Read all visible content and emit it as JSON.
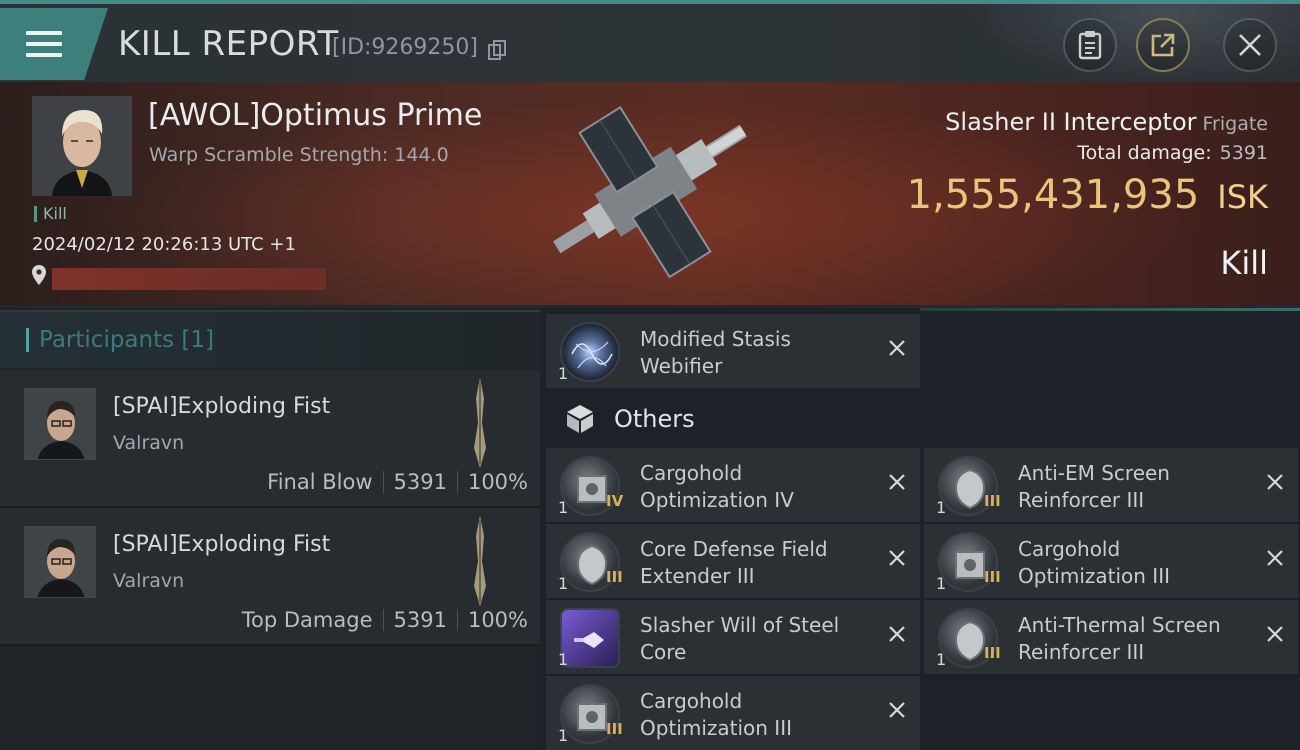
{
  "header": {
    "title": "KILL REPORT",
    "id_text": "[ID:9269250]"
  },
  "victim": {
    "name": "[AWOL]Optimus Prime",
    "subtitle": "Warp Scramble Strength: 144.0",
    "tag": "Kill",
    "datetime": "2024/02/12 20:26:13 UTC +1",
    "ship_name": "Slasher II Interceptor",
    "ship_class": "Frigate",
    "total_damage_label": "Total damage:",
    "total_damage": "5391",
    "isk_value": "1,555,431,935",
    "isk_unit": "ISK",
    "result": "Kill"
  },
  "participants": {
    "title": "Participants [1]",
    "rows": [
      {
        "name": "[SPAI]Exploding Fist",
        "ship": "Valravn",
        "role": "Final Blow",
        "damage": "5391",
        "percent": "100%"
      },
      {
        "name": "[SPAI]Exploding Fist",
        "ship": "Valravn",
        "role": "Top Damage",
        "damage": "5391",
        "percent": "100%"
      }
    ]
  },
  "modules": {
    "top": {
      "name": "Modified Stasis\nWebifier",
      "qty": "1",
      "icon": "stasis-webifier-icon",
      "tier": ""
    },
    "others_label": "Others",
    "left": [
      {
        "name": "Cargohold\nOptimization IV",
        "qty": "1",
        "tier": "IV",
        "icon": "cargohold-icon"
      },
      {
        "name": "Core Defense Field\nExtender III",
        "qty": "1",
        "tier": "III",
        "icon": "shield-rig-icon"
      },
      {
        "name": "Slasher Will of Steel\nCore",
        "qty": "1",
        "tier": "",
        "icon": "ship-core-icon"
      },
      {
        "name": "Cargohold\nOptimization III",
        "qty": "1",
        "tier": "III",
        "icon": "cargohold-icon"
      }
    ],
    "right": [
      {
        "name": "Anti-EM Screen\nReinforcer III",
        "qty": "1",
        "tier": "III",
        "icon": "shield-rig-icon"
      },
      {
        "name": "Cargohold\nOptimization III",
        "qty": "1",
        "tier": "III",
        "icon": "cargohold-icon"
      },
      {
        "name": "Anti-Thermal Screen\nReinforcer III",
        "qty": "1",
        "tier": "III",
        "icon": "shield-rig-icon"
      }
    ]
  },
  "colors": {
    "accent_teal": "#3d7f7a",
    "isk_gold": "#e9c47a",
    "tier_gold": "#d6b25a"
  }
}
